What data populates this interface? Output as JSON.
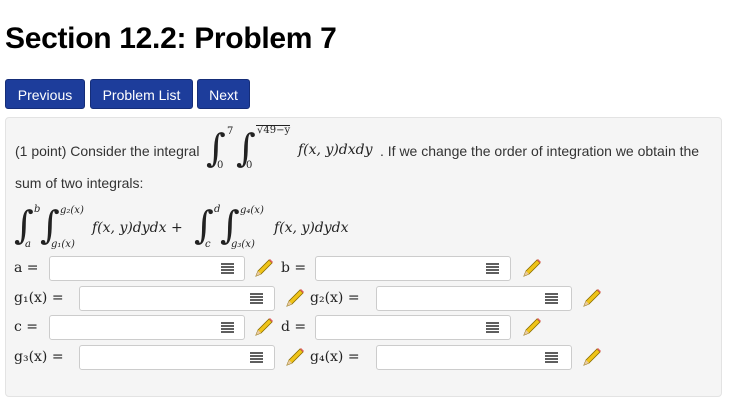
{
  "page_title": "Section 12.2: Problem 7",
  "nav": {
    "previous": "Previous",
    "problem_list": "Problem List",
    "next": "Next"
  },
  "problem": {
    "intro": "(1 point) Consider the integral",
    "integral_outer_upper": "7",
    "integral_outer_lower": "0",
    "integral_inner_upper": "√49−y",
    "integral_inner_lower": "0",
    "integrand": "f(x, y)dxdy",
    "after_integral": ". If we change the order of integration we obtain the",
    "line2": "sum of two integrals:",
    "sum": {
      "first_upper": "b",
      "first_lower": "a",
      "first_inner_upper": "g₂(x)",
      "first_inner_lower": "g₁(x)",
      "first_integrand": "f(x, y)dydx +",
      "second_upper": "d",
      "second_lower": "c",
      "second_inner_upper": "g₄(x)",
      "second_inner_lower": "g₃(x)",
      "second_integrand": "f(x, y)dydx"
    }
  },
  "answers": [
    {
      "label": "a =",
      "value": ""
    },
    {
      "label": "b =",
      "value": ""
    },
    {
      "label": "g₁(x) =",
      "value": ""
    },
    {
      "label": "g₂(x) =",
      "value": ""
    },
    {
      "label": "c =",
      "value": ""
    },
    {
      "label": "d =",
      "value": ""
    },
    {
      "label": "g₃(x) =",
      "value": ""
    },
    {
      "label": "g₄(x) =",
      "value": ""
    }
  ],
  "icons": {
    "palette": "matrix-grid-icon",
    "editor": "pencil-icon"
  },
  "colors": {
    "nav_button": "#1d3d9b",
    "well_background": "#f5f5f5"
  }
}
